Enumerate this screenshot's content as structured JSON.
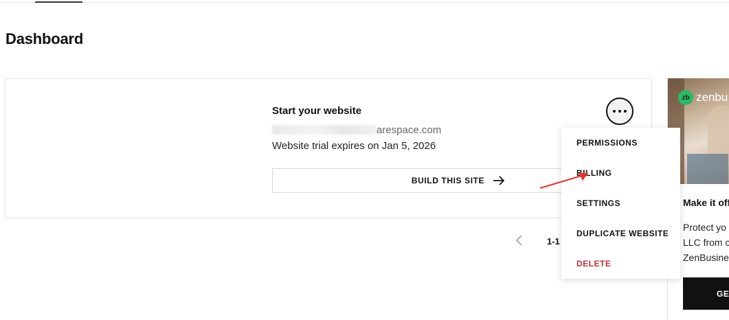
{
  "page": {
    "title": "Dashboard"
  },
  "site_card": {
    "name": "Start your website",
    "domain_visible": "arespace.com",
    "expiry": "Website trial expires on Jan 5, 2026",
    "build_label": "BUILD THIS SITE"
  },
  "menu": {
    "items": [
      {
        "label": "PERMISSIONS"
      },
      {
        "label": "BILLING"
      },
      {
        "label": "SETTINGS"
      },
      {
        "label": "DUPLICATE WEBSITE"
      },
      {
        "label": "DELETE"
      }
    ]
  },
  "pagination": {
    "count": "1-1"
  },
  "promo": {
    "brand": "zenbu",
    "logo_text": "zb",
    "headline": "Make it off",
    "body": [
      "Protect yo",
      "LLC from c",
      "ZenBusine"
    ],
    "button_label": "GE"
  },
  "icons": {
    "more": "more-horizontal-icon",
    "arrow": "arrow-right-icon",
    "prev": "chevron-left-icon"
  },
  "colors": {
    "accent": "#111111",
    "delete": "#c0303a",
    "brand_green": "#2fb866",
    "annotation": "#e8332a"
  }
}
